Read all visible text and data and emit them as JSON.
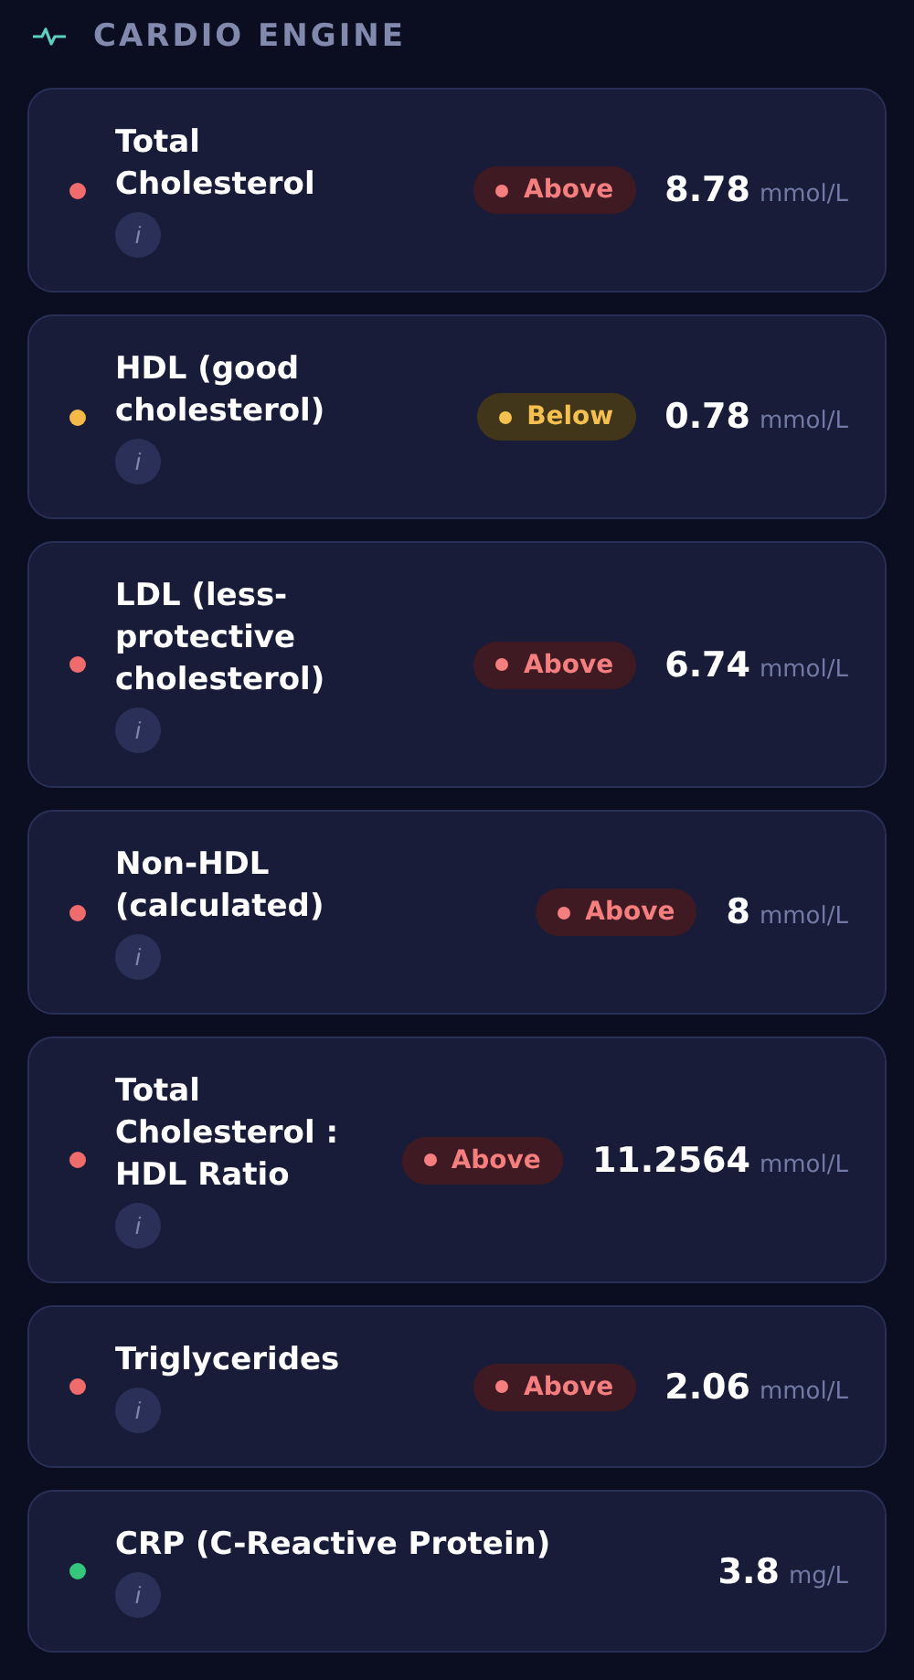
{
  "section": {
    "title": "CARDIO ENGINE"
  },
  "markers": [
    {
      "name": "Total Cholesterol",
      "info": "i",
      "color": "#f06b6b",
      "status": {
        "kind": "above",
        "label": "Above"
      },
      "value": "8.78",
      "unit": "mmol/L"
    },
    {
      "name": "HDL (good cholesterol)",
      "info": "i",
      "color": "#f5b94a",
      "status": {
        "kind": "below",
        "label": "Below"
      },
      "value": "0.78",
      "unit": "mmol/L"
    },
    {
      "name": "LDL (less-protective cholesterol)",
      "info": "i",
      "color": "#f06b6b",
      "status": {
        "kind": "above",
        "label": "Above"
      },
      "value": "6.74",
      "unit": "mmol/L"
    },
    {
      "name": "Non-HDL (calculated)",
      "info": "i",
      "color": "#f06b6b",
      "status": {
        "kind": "above",
        "label": "Above"
      },
      "value": "8",
      "unit": "mmol/L"
    },
    {
      "name": "Total Cholesterol : HDL Ratio",
      "info": "i",
      "color": "#f06b6b",
      "status": {
        "kind": "above",
        "label": "Above"
      },
      "value": "11.2564",
      "unit": "mmol/L"
    },
    {
      "name": "Triglycerides",
      "info": "i",
      "color": "#f06b6b",
      "status": {
        "kind": "above",
        "label": "Above"
      },
      "value": "2.06",
      "unit": "mmol/L"
    },
    {
      "name": "CRP (C-Reactive Protein)",
      "info": "i",
      "color": "#34c77b",
      "value": "3.8",
      "unit": "mg/L"
    }
  ]
}
